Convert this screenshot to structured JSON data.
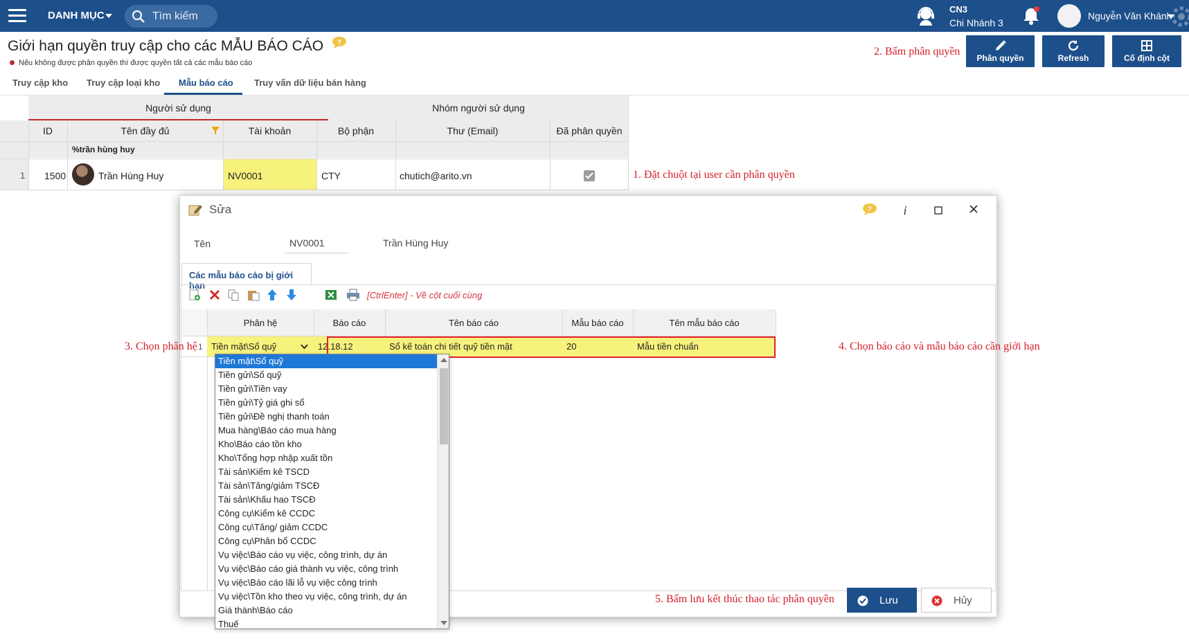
{
  "topbar": {
    "menu_label": "DANH MỤC",
    "search_placeholder": "Tìm kiếm",
    "branch_code": "CN3",
    "branch_name": "Chi Nhánh 3",
    "user_name": "Nguyễn Văn Khánh"
  },
  "page": {
    "title": "Giới hạn quyền truy cập cho các MẪU BÁO CÁO",
    "note": "Nếu không được phân quyền thì được quyền tất cả các mẫu báo cáo"
  },
  "toolbar": {
    "assign_label": "Phân quyền",
    "refresh_label": "Refresh",
    "fix_column_label": "Cố định cột"
  },
  "tabs": [
    "Truy cập kho",
    "Truy cập loại kho",
    "Mẫu báo cáo",
    "Truy vấn dữ liệu bán hàng"
  ],
  "grid": {
    "group_user": "Người sử dụng",
    "group_user_group": "Nhóm người sử dụng",
    "columns": [
      "ID",
      "Tên đầy đủ",
      "Tài khoản",
      "Bộ phận",
      "Thư (Email)",
      "Đã phân quyền"
    ],
    "filter_value": "%trần hùng huy",
    "row": {
      "index": "1",
      "id": "1500",
      "full_name": "Trần Hùng Huy",
      "account": "NV0001",
      "department": "CTY",
      "email": "chutich@arito.vn"
    }
  },
  "annotations": {
    "step1": "1. Đặt chuột tại user cần phân quyền",
    "step2": "2. Bấm phân quyền",
    "step3": "3. Chọn phân hệ",
    "step4": "4. Chọn báo cáo và mẫu báo cáo cần giới hạn",
    "step5": "5. Bấm lưu kết thúc thao tác phân quyền"
  },
  "dialog": {
    "title": "Sửa",
    "name_label": "Tên",
    "account": "NV0001",
    "full_name": "Trần Hùng Huy",
    "subtab": "Các mẫu báo cáo bị giới hạn",
    "hint": "[CtrlEnter] - Về cột cuối cùng",
    "columns": [
      "Phân hệ",
      "Báo cáo",
      "Tên báo cáo",
      "Mẫu báo cáo",
      "Tên mẫu báo cáo"
    ],
    "row": {
      "index": "1",
      "module": "Tiền mặt\\Sổ quỹ",
      "report": "12.18.12",
      "report_name": "Sổ kế toán chi tiết quỹ tiền mặt",
      "template": "20",
      "template_name": "Mẫu tiền chuẩn"
    },
    "save_label": "Lưu",
    "cancel_label": "Hủy"
  },
  "dropdown": {
    "options": [
      "Tiền mặt\\Sổ quỹ",
      "Tiền gửi\\Sổ quỹ",
      "Tiền gửi\\Tiền vay",
      "Tiền gửi\\Tỷ giá ghi sổ",
      "Tiền gửi\\Đề nghị thanh toán",
      "Mua hàng\\Báo cáo mua hàng",
      "Kho\\Báo cáo tồn kho",
      "Kho\\Tổng hợp nhập xuất tồn",
      "Tài sản\\Kiểm kê TSCD",
      "Tài sản\\Tăng/giảm TSCĐ",
      "Tài sản\\Khấu hao TSCĐ",
      "Công cụ\\Kiểm kê CCDC",
      "Công cụ\\Tăng/ giảm CCDC",
      "Công cụ\\Phân bổ CCDC",
      "Vụ việc\\Báo cáo vụ việc, công trình, dự án",
      "Vụ việc\\Báo cáo giá thành vụ việc, công trình",
      "Vụ việc\\Báo cáo lãi lỗ vụ việc công trình",
      "Vụ việc\\Tồn kho theo vụ việc, công trình, dự án",
      "Giá thành\\Báo cáo",
      "Thuế"
    ]
  }
}
